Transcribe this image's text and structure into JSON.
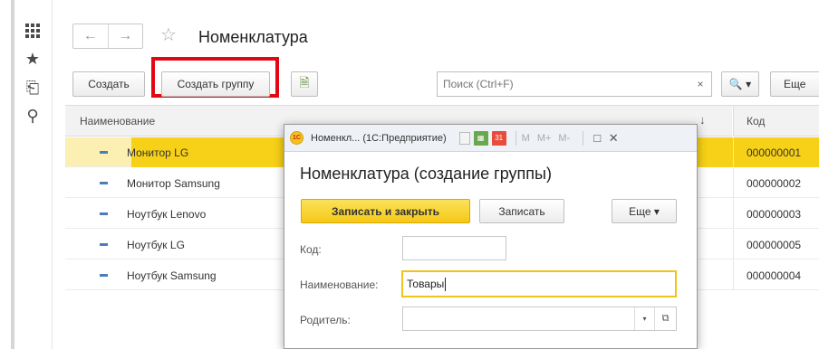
{
  "sidebar": {
    "items": [
      {
        "icon": "apps-grid-icon"
      },
      {
        "icon": "star-icon",
        "glyph": "★"
      },
      {
        "icon": "history-icon",
        "glyph": "⎗"
      },
      {
        "icon": "search-icon",
        "glyph": "⚲"
      }
    ]
  },
  "header": {
    "back_glyph": "←",
    "forward_glyph": "→",
    "star_glyph": "☆",
    "title": "Номенклатура"
  },
  "toolbar": {
    "create_label": "Создать",
    "create_group_label": "Создать группу",
    "doc_icon_glyph": "🗎",
    "search_placeholder": "Поиск (Ctrl+F)",
    "clear_glyph": "×",
    "search_button_label": "🔍 ▾",
    "more_label": "Еще"
  },
  "table": {
    "columns": {
      "name": "Наименование",
      "sort_glyph": "↓",
      "code": "Код"
    },
    "rows": [
      {
        "name": "Монитор LG",
        "code": "000000001",
        "selected": true
      },
      {
        "name": "Монитор Samsung",
        "code": "000000002"
      },
      {
        "name": "Ноутбук Lenovo",
        "code": "000000003"
      },
      {
        "name": "Ноутбук LG",
        "code": "000000005"
      },
      {
        "name": "Ноутбук Samsung",
        "code": "000000004"
      }
    ]
  },
  "dialog": {
    "logo_text": "1С",
    "window_title": "Номенкл... (1С:Предприятие)",
    "mem_labels": [
      "M",
      "M+",
      "M-"
    ],
    "minimize_glyph": "□",
    "close_glyph": "✕",
    "heading": "Номенклатура (создание группы)",
    "save_close_label": "Записать и закрыть",
    "save_label": "Записать",
    "more_label": "Еще ▾",
    "fields": {
      "code_label": "Код:",
      "code_value": "",
      "name_label": "Наименование:",
      "name_value": "Товары",
      "parent_label": "Родитель:",
      "parent_value": "",
      "dropdown_glyph": "▾",
      "open_glyph": "⧉"
    }
  },
  "colors": {
    "selection": "#f7d117",
    "highlight_frame": "#e30613",
    "primary_button": "#f5c817"
  }
}
